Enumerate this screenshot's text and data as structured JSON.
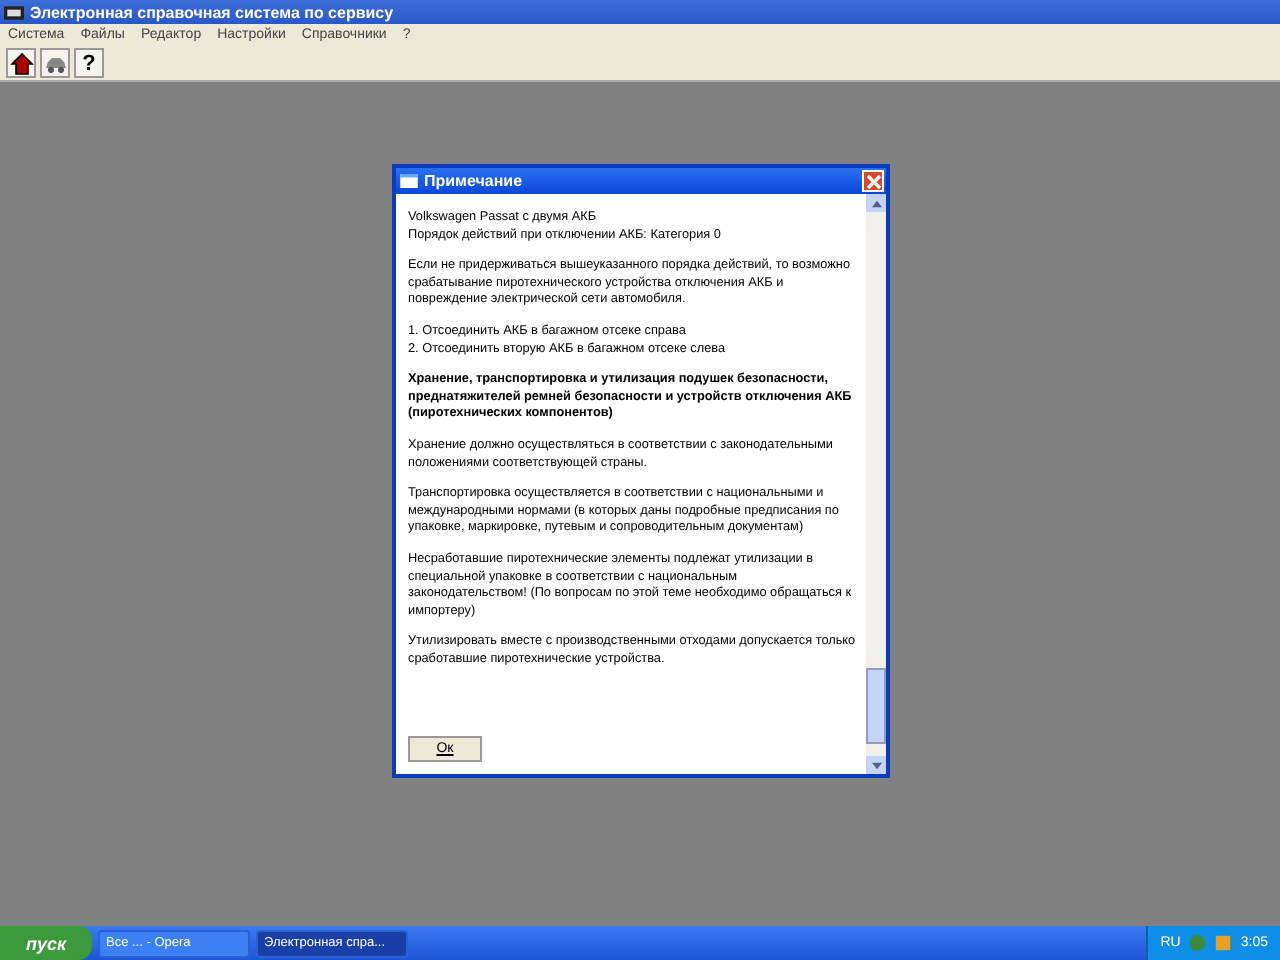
{
  "window": {
    "title": "Электронная справочная система по сервису"
  },
  "menu": [
    "Система",
    "Файлы",
    "Редактор",
    "Настройки",
    "Справочники",
    "?"
  ],
  "toolbar": [
    {
      "kind": "home"
    },
    {
      "kind": "car"
    },
    {
      "kind": "help",
      "label": "?"
    }
  ],
  "dialog": {
    "title": "Примечание",
    "paragraphs": [
      {
        "bold": false,
        "lines": [
          "Volkswagen Passat с двумя АКБ",
          "Порядок действий при отключении АКБ: Категория 0"
        ]
      },
      {
        "bold": false,
        "lines": [
          "Если не придерживаться вышеуказанного порядка действий, то возможно срабатывание пиротехнического устройства отключения АКБ и повреждение электрической сети автомобиля."
        ]
      },
      {
        "bold": false,
        "lines": [
          "1. Отсоединить АКБ в багажном отсеке справа",
          "2. Отсоединить вторую АКБ в багажном отсеке слева"
        ]
      },
      {
        "bold": true,
        "lines": [
          "Хранение, транспортировка и утилизация подушек безопасности, преднатяжителей ремней безопасности и устройств отключения АКБ (пиротехнических компонентов)"
        ]
      },
      {
        "bold": false,
        "lines": [
          "Хранение должно осуществляться в соответствии с законодательными положениями соответствующей страны."
        ]
      },
      {
        "bold": false,
        "lines": [
          "Транспортировка осуществляется в соответствии с национальными и международными нормами (в которых даны подробные предписания по упаковке, маркировке, путевым и сопроводительным документам)"
        ]
      },
      {
        "bold": false,
        "lines": [
          "Несработавшие пиротехнические элементы подлежат утилизации в специальной упаковке в соответствии с национальным законодательством! (По вопросам по этой теме необходимо обращаться к импортеру)"
        ]
      },
      {
        "bold": false,
        "lines": [
          "Утилизировать вместе с производственными отходами допускается только сработавшие пиротехнические устройства."
        ]
      }
    ],
    "button": "Ок"
  },
  "taskbar": {
    "start": "пуск",
    "items": [
      {
        "label": "Все ... - Opera",
        "selected": false
      },
      {
        "label": "Электронная спра...",
        "selected": true
      }
    ],
    "language": "RU",
    "clock": "3:05"
  }
}
